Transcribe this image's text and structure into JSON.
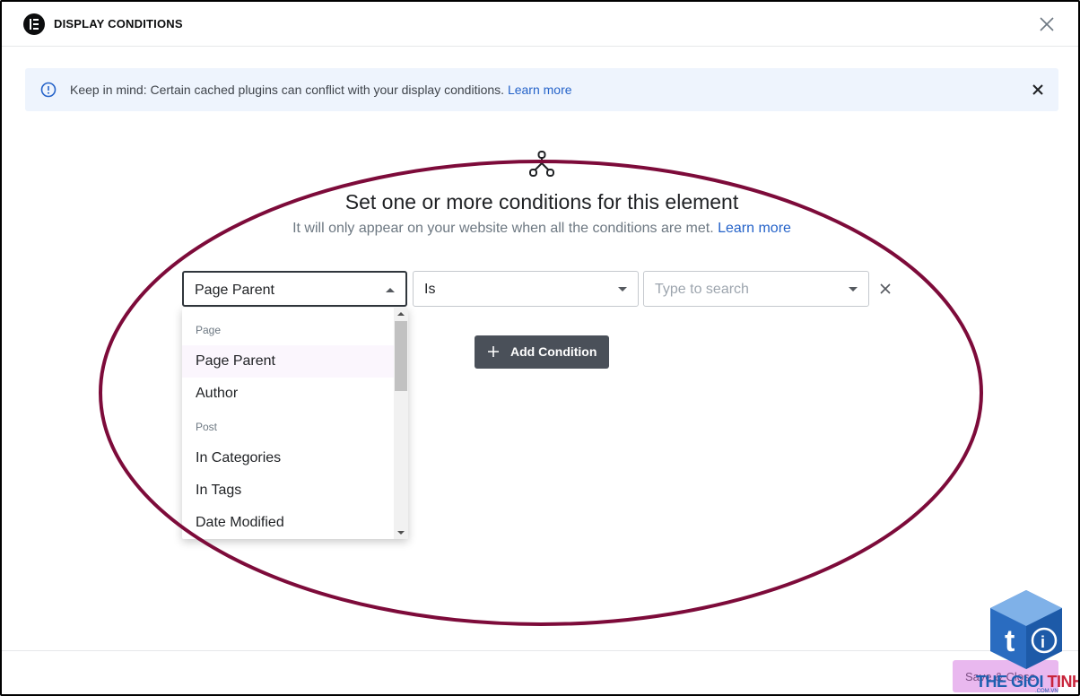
{
  "header": {
    "title": "DISPLAY CONDITIONS"
  },
  "alert": {
    "message": "Keep in mind: Certain cached plugins can conflict with your display conditions.",
    "link": "Learn more"
  },
  "intro": {
    "heading": "Set one or more conditions for this element",
    "subtext": "It will only appear on your website when all the conditions are met.",
    "link": "Learn more"
  },
  "condition": {
    "field": "Page Parent",
    "operator": "Is",
    "value_placeholder": "Type to search"
  },
  "dropdown": {
    "groups": [
      {
        "label": "Page",
        "items": [
          "Page Parent",
          "Author"
        ]
      },
      {
        "label": "Post",
        "items": [
          "In Categories",
          "In Tags",
          "Date Modified"
        ]
      }
    ],
    "selected": "Page Parent"
  },
  "actions": {
    "add_condition": "Add Condition",
    "save": "Save & Close"
  },
  "watermark": {
    "brand_blue": "THE GIOI",
    "brand_red": "TINHOC",
    "domain": ".COM.VN"
  },
  "colors": {
    "accent": "#2563c9",
    "annotation": "#7d0b3a",
    "save_button": "#e9b8ef"
  }
}
